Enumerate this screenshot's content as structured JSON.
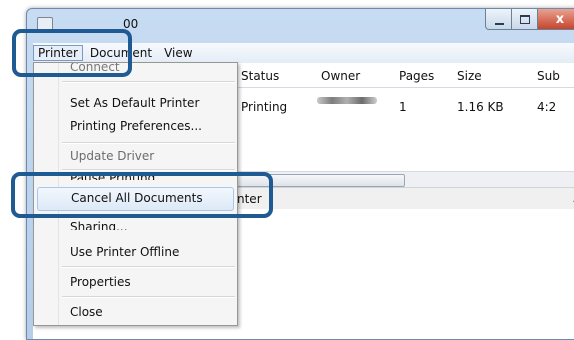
{
  "window": {
    "title_text": "00",
    "controls": {
      "minimize": "",
      "maximize": "",
      "close": "x"
    }
  },
  "menubar": {
    "items": [
      {
        "label": "Printer",
        "state": "open"
      },
      {
        "label": "Document"
      },
      {
        "label": "View"
      }
    ]
  },
  "table": {
    "columns": [
      "Status",
      "Owner",
      "Pages",
      "Size",
      "Sub"
    ],
    "rows": [
      {
        "status": "Printing",
        "owner": "",
        "pages": "1",
        "size": "1.16 KB",
        "submitted": "4:2"
      }
    ]
  },
  "statusbar": {
    "text": "nter"
  },
  "printer_menu": {
    "items": [
      {
        "label": "Connect",
        "disabled": false
      },
      {
        "label": "Set As Default Printer",
        "disabled": false
      },
      {
        "label": "Printing Preferences...",
        "disabled": false
      },
      {
        "label": "Update Driver",
        "disabled": true
      },
      {
        "label": "Pause Printing",
        "disabled": false
      },
      {
        "label": "Cancel All Documents",
        "highlighted": true
      },
      {
        "label": "Sharing...",
        "disabled": false
      },
      {
        "label": "Use Printer Offline",
        "disabled": false
      },
      {
        "label": "Properties",
        "disabled": false
      },
      {
        "label": "Close",
        "disabled": false
      }
    ]
  },
  "colors": {
    "callout": "#1f5a93",
    "menu_highlight_border": "#a8c7ec",
    "close_button": "#c6452b"
  },
  "icons": {
    "scroll_right": "▸",
    "size_grip": "⋰"
  }
}
